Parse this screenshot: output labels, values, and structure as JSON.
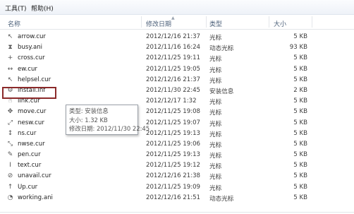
{
  "menubar": {
    "tools": "工具(T)",
    "help": "帮助(H)"
  },
  "columns": {
    "name": "名称",
    "date": "修改日期",
    "type": "类型",
    "size": "大小"
  },
  "files": [
    {
      "icon": "arrow-cursor-icon",
      "glyph": "↖",
      "name": "arrow.cur",
      "date": "2012/12/16 21:37",
      "type": "光标",
      "size": "5 KB"
    },
    {
      "icon": "busy-cursor-icon",
      "glyph": "⧗",
      "name": "busy.ani",
      "date": "2012/11/16 16:24",
      "type": "动态光标",
      "size": "93 KB"
    },
    {
      "icon": "cross-cursor-icon",
      "glyph": "+",
      "name": "cross.cur",
      "date": "2012/11/25 19:11",
      "type": "光标",
      "size": "5 KB"
    },
    {
      "icon": "ew-cursor-icon",
      "glyph": "↔",
      "name": "ew.cur",
      "date": "2012/11/25 19:05",
      "type": "光标",
      "size": "5 KB"
    },
    {
      "icon": "helpsel-cursor-icon",
      "glyph": "↖",
      "name": "helpsel.cur",
      "date": "2012/12/16 21:37",
      "type": "光标",
      "size": "5 KB"
    },
    {
      "icon": "setup-info-file-icon",
      "glyph": "⚙",
      "name": "install.inf",
      "date": "2012/11/30 22:45",
      "type": "安装信息",
      "size": "2 KB"
    },
    {
      "icon": "link-cursor-icon",
      "glyph": "☝",
      "name": "link.cur",
      "date": "2012/12/17 1:32",
      "type": "光标",
      "size": "5 KB"
    },
    {
      "icon": "move-cursor-icon",
      "glyph": "✥",
      "name": "move.cur",
      "date": "2012/11/25 19:08",
      "type": "光标",
      "size": "5 KB"
    },
    {
      "icon": "nesw-cursor-icon",
      "glyph": "⤢",
      "name": "nesw.cur",
      "date": "2012/11/25 19:07",
      "type": "光标",
      "size": "5 KB"
    },
    {
      "icon": "ns-cursor-icon",
      "glyph": "↕",
      "name": "ns.cur",
      "date": "2012/11/25 19:13",
      "type": "光标",
      "size": "5 KB"
    },
    {
      "icon": "nwse-cursor-icon",
      "glyph": "⤡",
      "name": "nwse.cur",
      "date": "2012/11/25 19:06",
      "type": "光标",
      "size": "5 KB"
    },
    {
      "icon": "pen-cursor-icon",
      "glyph": "✎",
      "name": "pen.cur",
      "date": "2012/11/25 19:13",
      "type": "光标",
      "size": "5 KB"
    },
    {
      "icon": "text-cursor-icon",
      "glyph": "I",
      "name": "text.cur",
      "date": "2012/11/25 19:12",
      "type": "光标",
      "size": "5 KB"
    },
    {
      "icon": "unavail-cursor-icon",
      "glyph": "⊘",
      "name": "unavail.cur",
      "date": "2012/12/16 21:38",
      "type": "光标",
      "size": "5 KB"
    },
    {
      "icon": "up-cursor-icon",
      "glyph": "↑",
      "name": "Up.cur",
      "date": "2012/11/25 19:09",
      "type": "光标",
      "size": "5 KB"
    },
    {
      "icon": "working-cursor-icon",
      "glyph": "◔",
      "name": "working.ani",
      "date": "2012/12/16 21:51",
      "type": "动态光标",
      "size": "5 KB"
    }
  ],
  "tooltip": {
    "type_line": "类型: 安装信息",
    "size_line": "大小: 1.32 KB",
    "date_line": "修改日期: 2012/11/30 22:45"
  },
  "colors": {
    "highlight_border": "#8b2a2a",
    "header_text": "#4c607a"
  }
}
